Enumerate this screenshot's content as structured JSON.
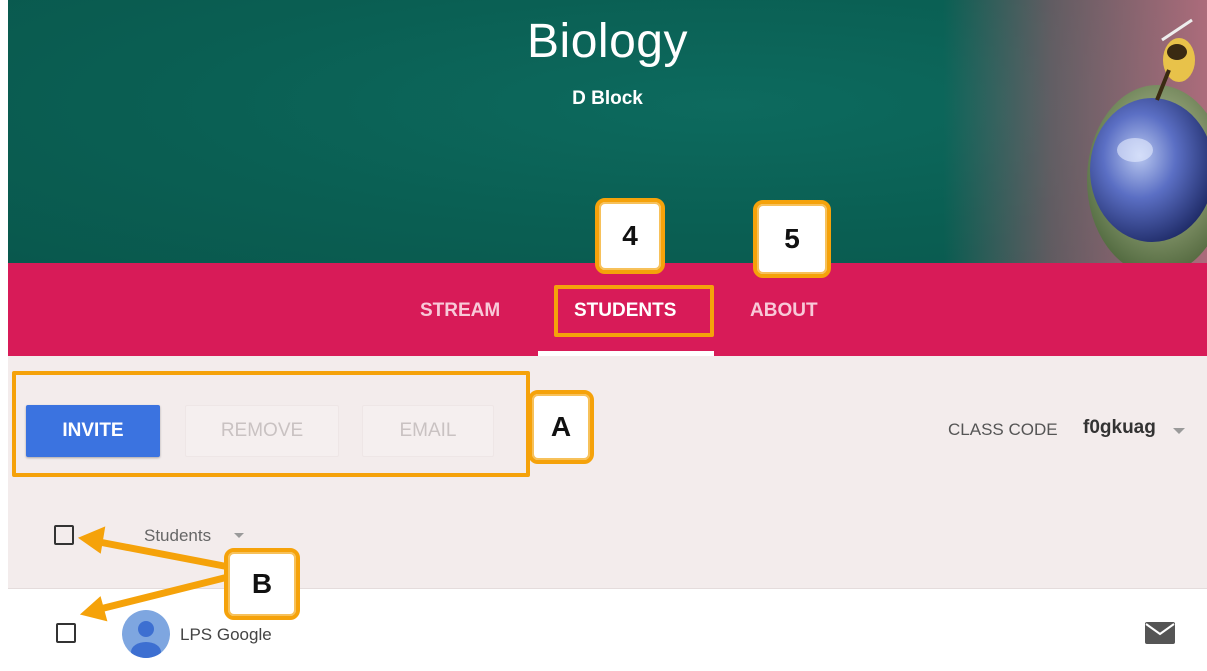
{
  "header": {
    "class_title": "Biology",
    "class_section": "D Block"
  },
  "tabs": [
    {
      "label": "STREAM",
      "active": false
    },
    {
      "label": "STUDENTS",
      "active": true
    },
    {
      "label": "ABOUT",
      "active": false
    }
  ],
  "toolbar": {
    "invite_label": "INVITE",
    "remove_label": "REMOVE",
    "email_label": "EMAIL",
    "class_code_label": "CLASS CODE",
    "class_code_value": "f0gkuag"
  },
  "students": {
    "header_label": "Students",
    "rows": [
      {
        "name": "LPS Google"
      }
    ]
  },
  "annotations": {
    "callout_4": "4",
    "callout_5": "5",
    "callout_a": "A",
    "callout_b": "B"
  },
  "colors": {
    "banner": "#0a5f53",
    "tab_bar": "#d81b58",
    "invite": "#3b73e0",
    "annotation": "#f5a20a"
  },
  "icons": {
    "caret": "chevron-down-icon",
    "mail": "mail-icon",
    "avatar": "person-icon"
  }
}
